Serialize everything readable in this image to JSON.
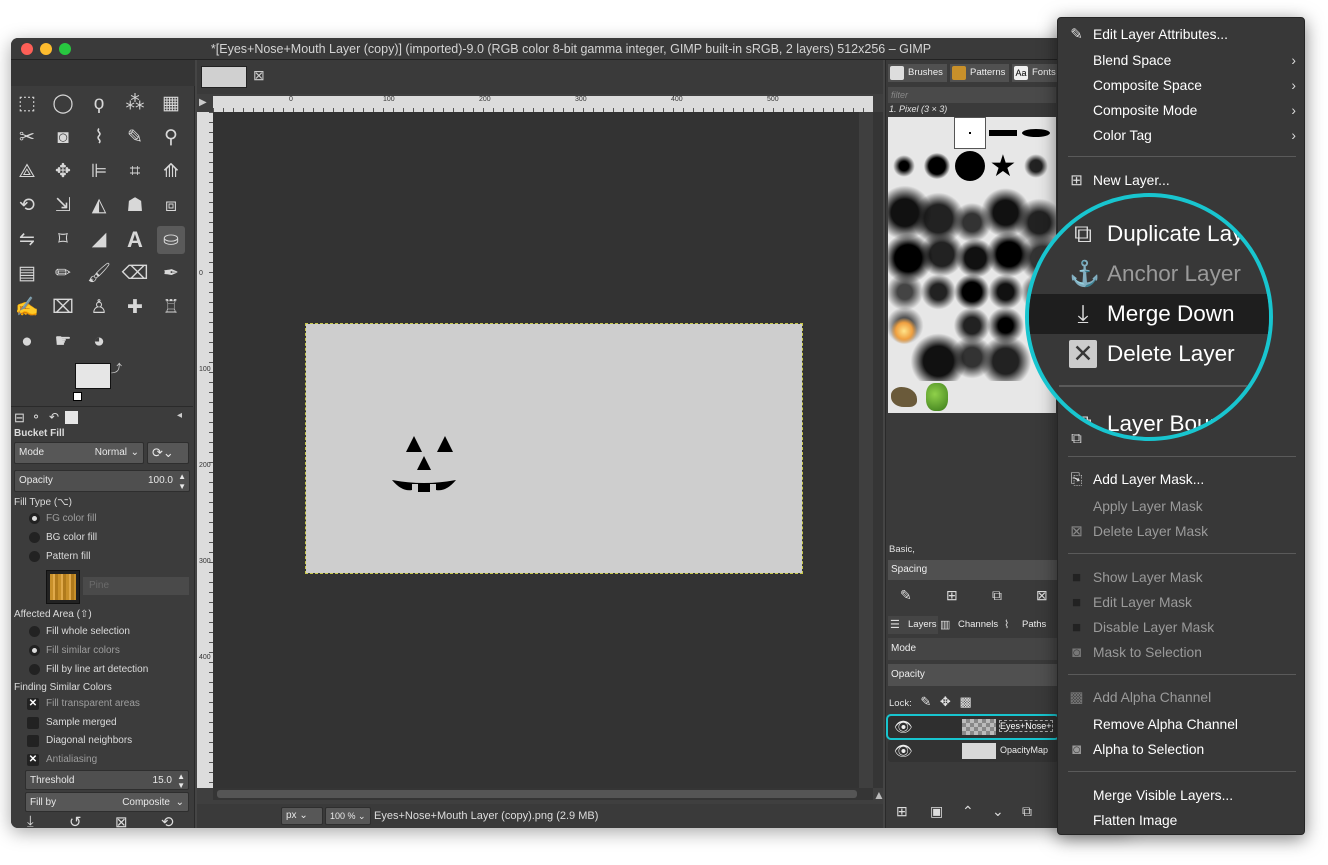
{
  "window": {
    "title": "*[Eyes+Nose+Mouth Layer (copy)] (imported)-9.0 (RGB color 8-bit gamma integer, GIMP built-in sRGB, 2 layers) 512x256 – GIMP"
  },
  "toolbox": {
    "tool_name": "Bucket Fill",
    "mode_label": "Mode",
    "mode_value": "Normal",
    "opacity_label": "Opacity",
    "opacity_value": "100.0",
    "fill_type_label": "Fill Type  (⌥)",
    "fill_types": [
      "FG color fill",
      "BG color fill",
      "Pattern fill"
    ],
    "pattern_name": "Pine",
    "affected_area_label": "Affected Area  (⇧)",
    "affected_areas": [
      "Fill whole selection",
      "Fill similar colors",
      "Fill by line art detection"
    ],
    "finding_label": "Finding Similar Colors",
    "finding_options": [
      "Fill transparent areas",
      "Sample merged",
      "Diagonal neighbors",
      "Antialiasing"
    ],
    "threshold_label": "Threshold",
    "threshold_value": "15.0",
    "fill_by_label": "Fill by",
    "fill_by_value": "Composite"
  },
  "canvas": {
    "ruler_ticks": [
      "0",
      "100",
      "200",
      "300",
      "400",
      "500"
    ],
    "ruler_v_ticks": [
      "0",
      "100",
      "200",
      "300",
      "400"
    ],
    "unit": "px",
    "zoom": "100 %",
    "status_text": "Eyes+Nose+Mouth Layer (copy).png (2.9 MB)"
  },
  "right_panel": {
    "tabs": [
      "Brushes",
      "Patterns",
      "Fonts"
    ],
    "filter_placeholder": "filter",
    "brush_name": "1. Pixel (3 × 3)",
    "preset": "Basic,",
    "spacing_label": "Spacing",
    "layer_tabs": [
      "Layers",
      "Channels",
      "Paths"
    ],
    "mode_label": "Mode",
    "opacity_label": "Opacity",
    "lock_label": "Lock:",
    "layers": [
      "Eyes+Nose+",
      "OpacityMap"
    ]
  },
  "menu": {
    "items": [
      {
        "label": "Edit Layer Attributes..."
      },
      {
        "label": "Blend Space"
      },
      {
        "label": "Composite Space"
      },
      {
        "label": "Composite Mode"
      },
      {
        "label": "Color Tag"
      },
      {
        "label": "New Layer..."
      },
      {
        "label": "Add Layer Mask..."
      },
      {
        "label": "Apply Layer Mask"
      },
      {
        "label": "Delete Layer Mask"
      },
      {
        "label": "Show Layer Mask"
      },
      {
        "label": "Edit Layer Mask"
      },
      {
        "label": "Disable Layer Mask"
      },
      {
        "label": "Mask to Selection"
      },
      {
        "label": "Add Alpha Channel"
      },
      {
        "label": "Remove Alpha Channel"
      },
      {
        "label": "Alpha to Selection"
      },
      {
        "label": "Merge Visible Layers..."
      },
      {
        "label": "Flatten Image"
      }
    ]
  },
  "magnifier": {
    "items": [
      {
        "label": "Duplicate Lay"
      },
      {
        "label": "Anchor Layer"
      },
      {
        "label": "Merge Down"
      },
      {
        "label": "Delete Layer"
      },
      {
        "label": "Layer Bound"
      }
    ],
    "accent": "#18c5cf"
  }
}
